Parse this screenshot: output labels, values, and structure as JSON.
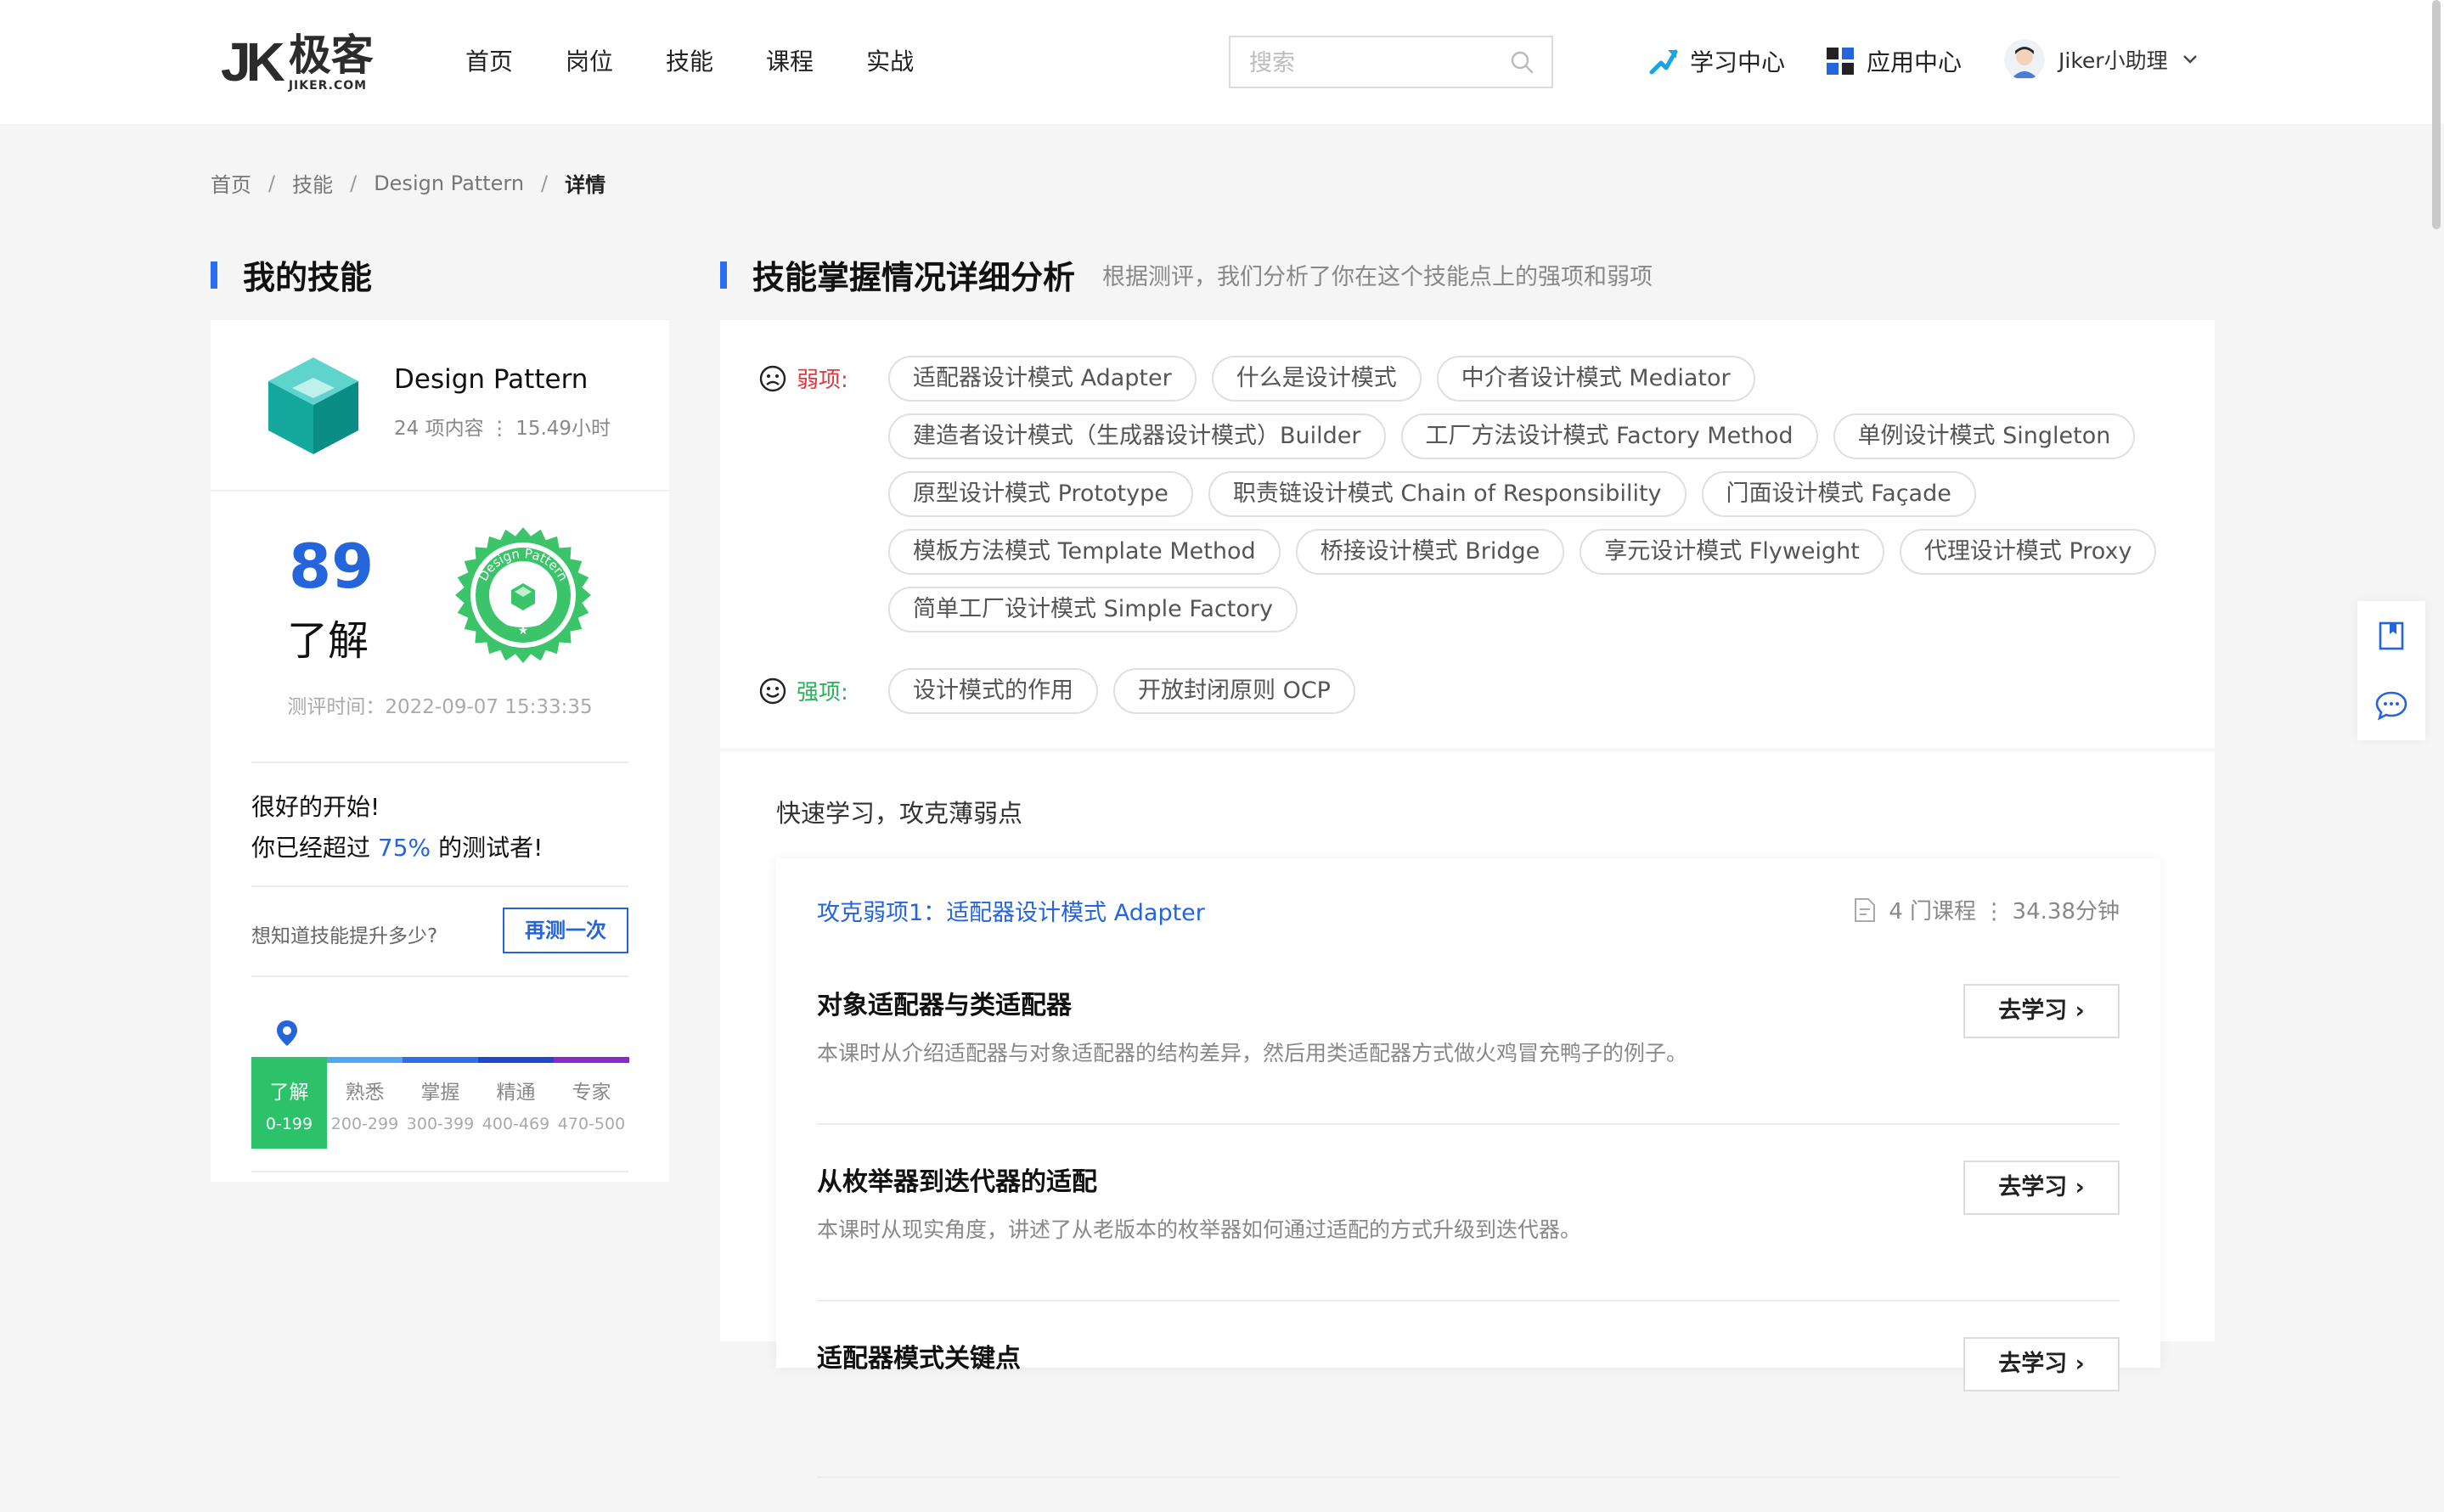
{
  "header": {
    "logo_cn": "极客",
    "logo_en": "JIKER.COM",
    "nav": [
      "首页",
      "岗位",
      "技能",
      "课程",
      "实战"
    ],
    "search_placeholder": "搜索",
    "learning_center": "学习中心",
    "app_center": "应用中心",
    "user_name": "Jiker小助理"
  },
  "breadcrumb": [
    "首页",
    "技能",
    "Design Pattern",
    "详情"
  ],
  "left": {
    "section_title": "我的技能",
    "skill_name": "Design Pattern",
    "skill_meta": "24 项内容 ⋮ 15.49小时",
    "score": "89",
    "level": "了解",
    "badge_text": "Design Pattern",
    "test_time": "测评时间：2022-09-07 15:33:35",
    "msg_line1": "很好的开始!",
    "msg_prefix": "你已经超过",
    "msg_pct": "75%",
    "msg_suffix": "的测试者!",
    "retest_question": "想知道技能提升多少?",
    "retest_button": "再测一次",
    "levels": [
      {
        "name": "了解",
        "range": "0-199"
      },
      {
        "name": "熟悉",
        "range": "200-299"
      },
      {
        "name": "掌握",
        "range": "300-399"
      },
      {
        "name": "精通",
        "range": "400-469"
      },
      {
        "name": "专家",
        "range": "470-500"
      }
    ],
    "level_colors": [
      "#2bc26a",
      "#4fa8f0",
      "#2e6fe6",
      "#1f49c9",
      "#8a2bc8"
    ]
  },
  "right": {
    "section_title": "技能掌握情况详细分析",
    "section_subtitle": "根据测评，我们分析了你在这个技能点上的强项和弱项",
    "weak_label": "弱项:",
    "weak_tags": [
      "适配器设计模式 Adapter",
      "什么是设计模式",
      "中介者设计模式 Mediator",
      "建造者设计模式（生成器设计模式）Builder",
      "工厂方法设计模式 Factory Method",
      "单例设计模式 Singleton",
      "原型设计模式 Prototype",
      "职责链设计模式 Chain of Responsibility",
      "门面设计模式 Façade",
      "模板方法模式 Template Method",
      "桥接设计模式 Bridge",
      "享元设计模式 Flyweight",
      "代理设计模式 Proxy",
      "简单工厂设计模式 Simple Factory"
    ],
    "strong_label": "强项:",
    "strong_tags": [
      "设计模式的作用",
      "开放封闭原则 OCP"
    ],
    "quick_title": "快速学习，攻克薄弱点",
    "weak_point_prefix": "攻克弱项1：",
    "weak_point_name": "适配器设计模式 Adapter",
    "course_meta": "4 门课程 ⋮ 34.38分钟",
    "go_label": "去学习",
    "courses": [
      {
        "title": "对象适配器与类适配器",
        "desc": "本课时从介绍适配器与对象适配器的结构差异，然后用类适配器方式做火鸡冒充鸭子的例子。"
      },
      {
        "title": "从枚举器到迭代器的适配",
        "desc": "本课时从现实角度，讲述了从老版本的枚举器如何通过适配的方式升级到迭代器。"
      },
      {
        "title": "适配器模式关键点",
        "desc": ""
      }
    ]
  },
  "colors": {
    "accent": "#2465dc",
    "weak": "#e0393e",
    "strong": "#27b25a",
    "badge_green": "#3bc46a"
  }
}
